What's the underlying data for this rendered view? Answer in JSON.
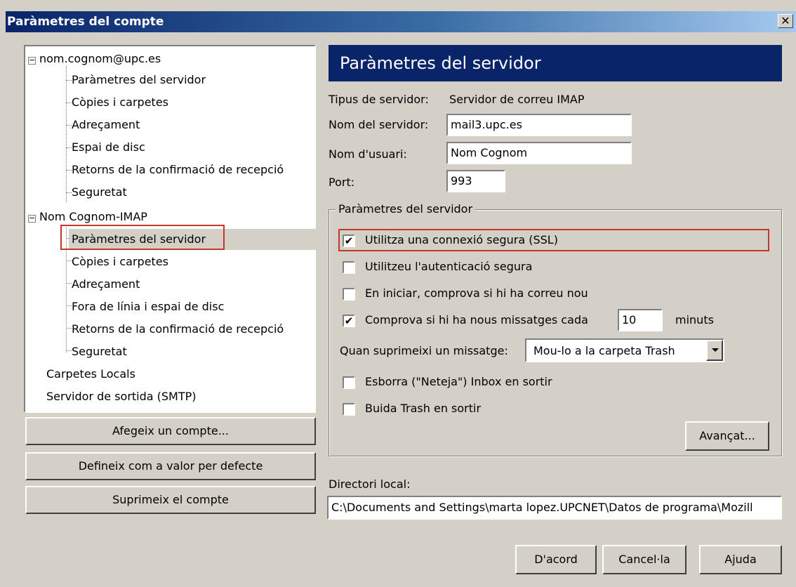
{
  "window": {
    "title": "Paràmetres del compte",
    "close_label": "✕"
  },
  "tree": {
    "account1": "nom.cognom@upc.es",
    "account1_items": [
      "Paràmetres del servidor",
      "Còpies i carpetes",
      "Adreçament",
      "Espai de disc",
      "Retorns de la confirmació de recepció",
      "Seguretat"
    ],
    "account2": "Nom Cognom-IMAP",
    "account2_items": [
      "Paràmetres del servidor",
      "Còpies i carpetes",
      "Adreçament",
      "Fora de línia i espai de disc",
      "Retorns de la confirmació de recepció",
      "Seguretat"
    ],
    "local_folders": "Carpetes Locals",
    "smtp": "Servidor de sortida (SMTP)",
    "expander_symbol": "−"
  },
  "left_buttons": {
    "add_account": "Afegeix un compte...",
    "set_default": "Defineix com a valor per defecte",
    "remove_account": "Suprimeix el compte"
  },
  "panel": {
    "header": "Paràmetres del servidor",
    "server_type_label": "Tipus de servidor:",
    "server_type_value": "Servidor de correu IMAP",
    "server_name_label": "Nom del servidor:",
    "server_name_value": "mail3.upc.es",
    "username_label": "Nom d'usuari:",
    "username_value": "Nom Cognom",
    "port_label": "Port:",
    "port_value": "993"
  },
  "settings_group": {
    "legend": "Paràmetres del servidor",
    "ssl_label": "Utilitza una connexió segura (SSL)",
    "ssl_checked": true,
    "secure_auth_label": "Utilitzeu l'autenticació segura",
    "secure_auth_checked": false,
    "check_startup_label": "En iniciar, comprova si hi ha correu nou",
    "check_startup_checked": false,
    "check_every_label": "Comprova si hi ha nous missatges cada",
    "check_every_checked": true,
    "check_every_value": "10",
    "minutes_label": "minuts",
    "delete_label": "Quan suprimeixi un missatge:",
    "delete_value": "Mou-lo a la carpeta Trash",
    "expunge_label": "Esborra (\"Neteja\") Inbox en sortir",
    "expunge_checked": false,
    "empty_trash_label": "Buida Trash en sortir",
    "empty_trash_checked": false,
    "advanced_button": "Avançat..."
  },
  "local_dir": {
    "label": "Directori local:",
    "value": "C:\\Documents and Settings\\marta lopez.UPCNET\\Datos de programa\\Mozill"
  },
  "dialog_buttons": {
    "ok": "D'acord",
    "cancel": "Cancel·la",
    "help": "Ajuda"
  },
  "colors": {
    "highlight_border": "#c0392b",
    "header_bg": "#0a246a",
    "dialog_bg": "#d4d0c8"
  }
}
